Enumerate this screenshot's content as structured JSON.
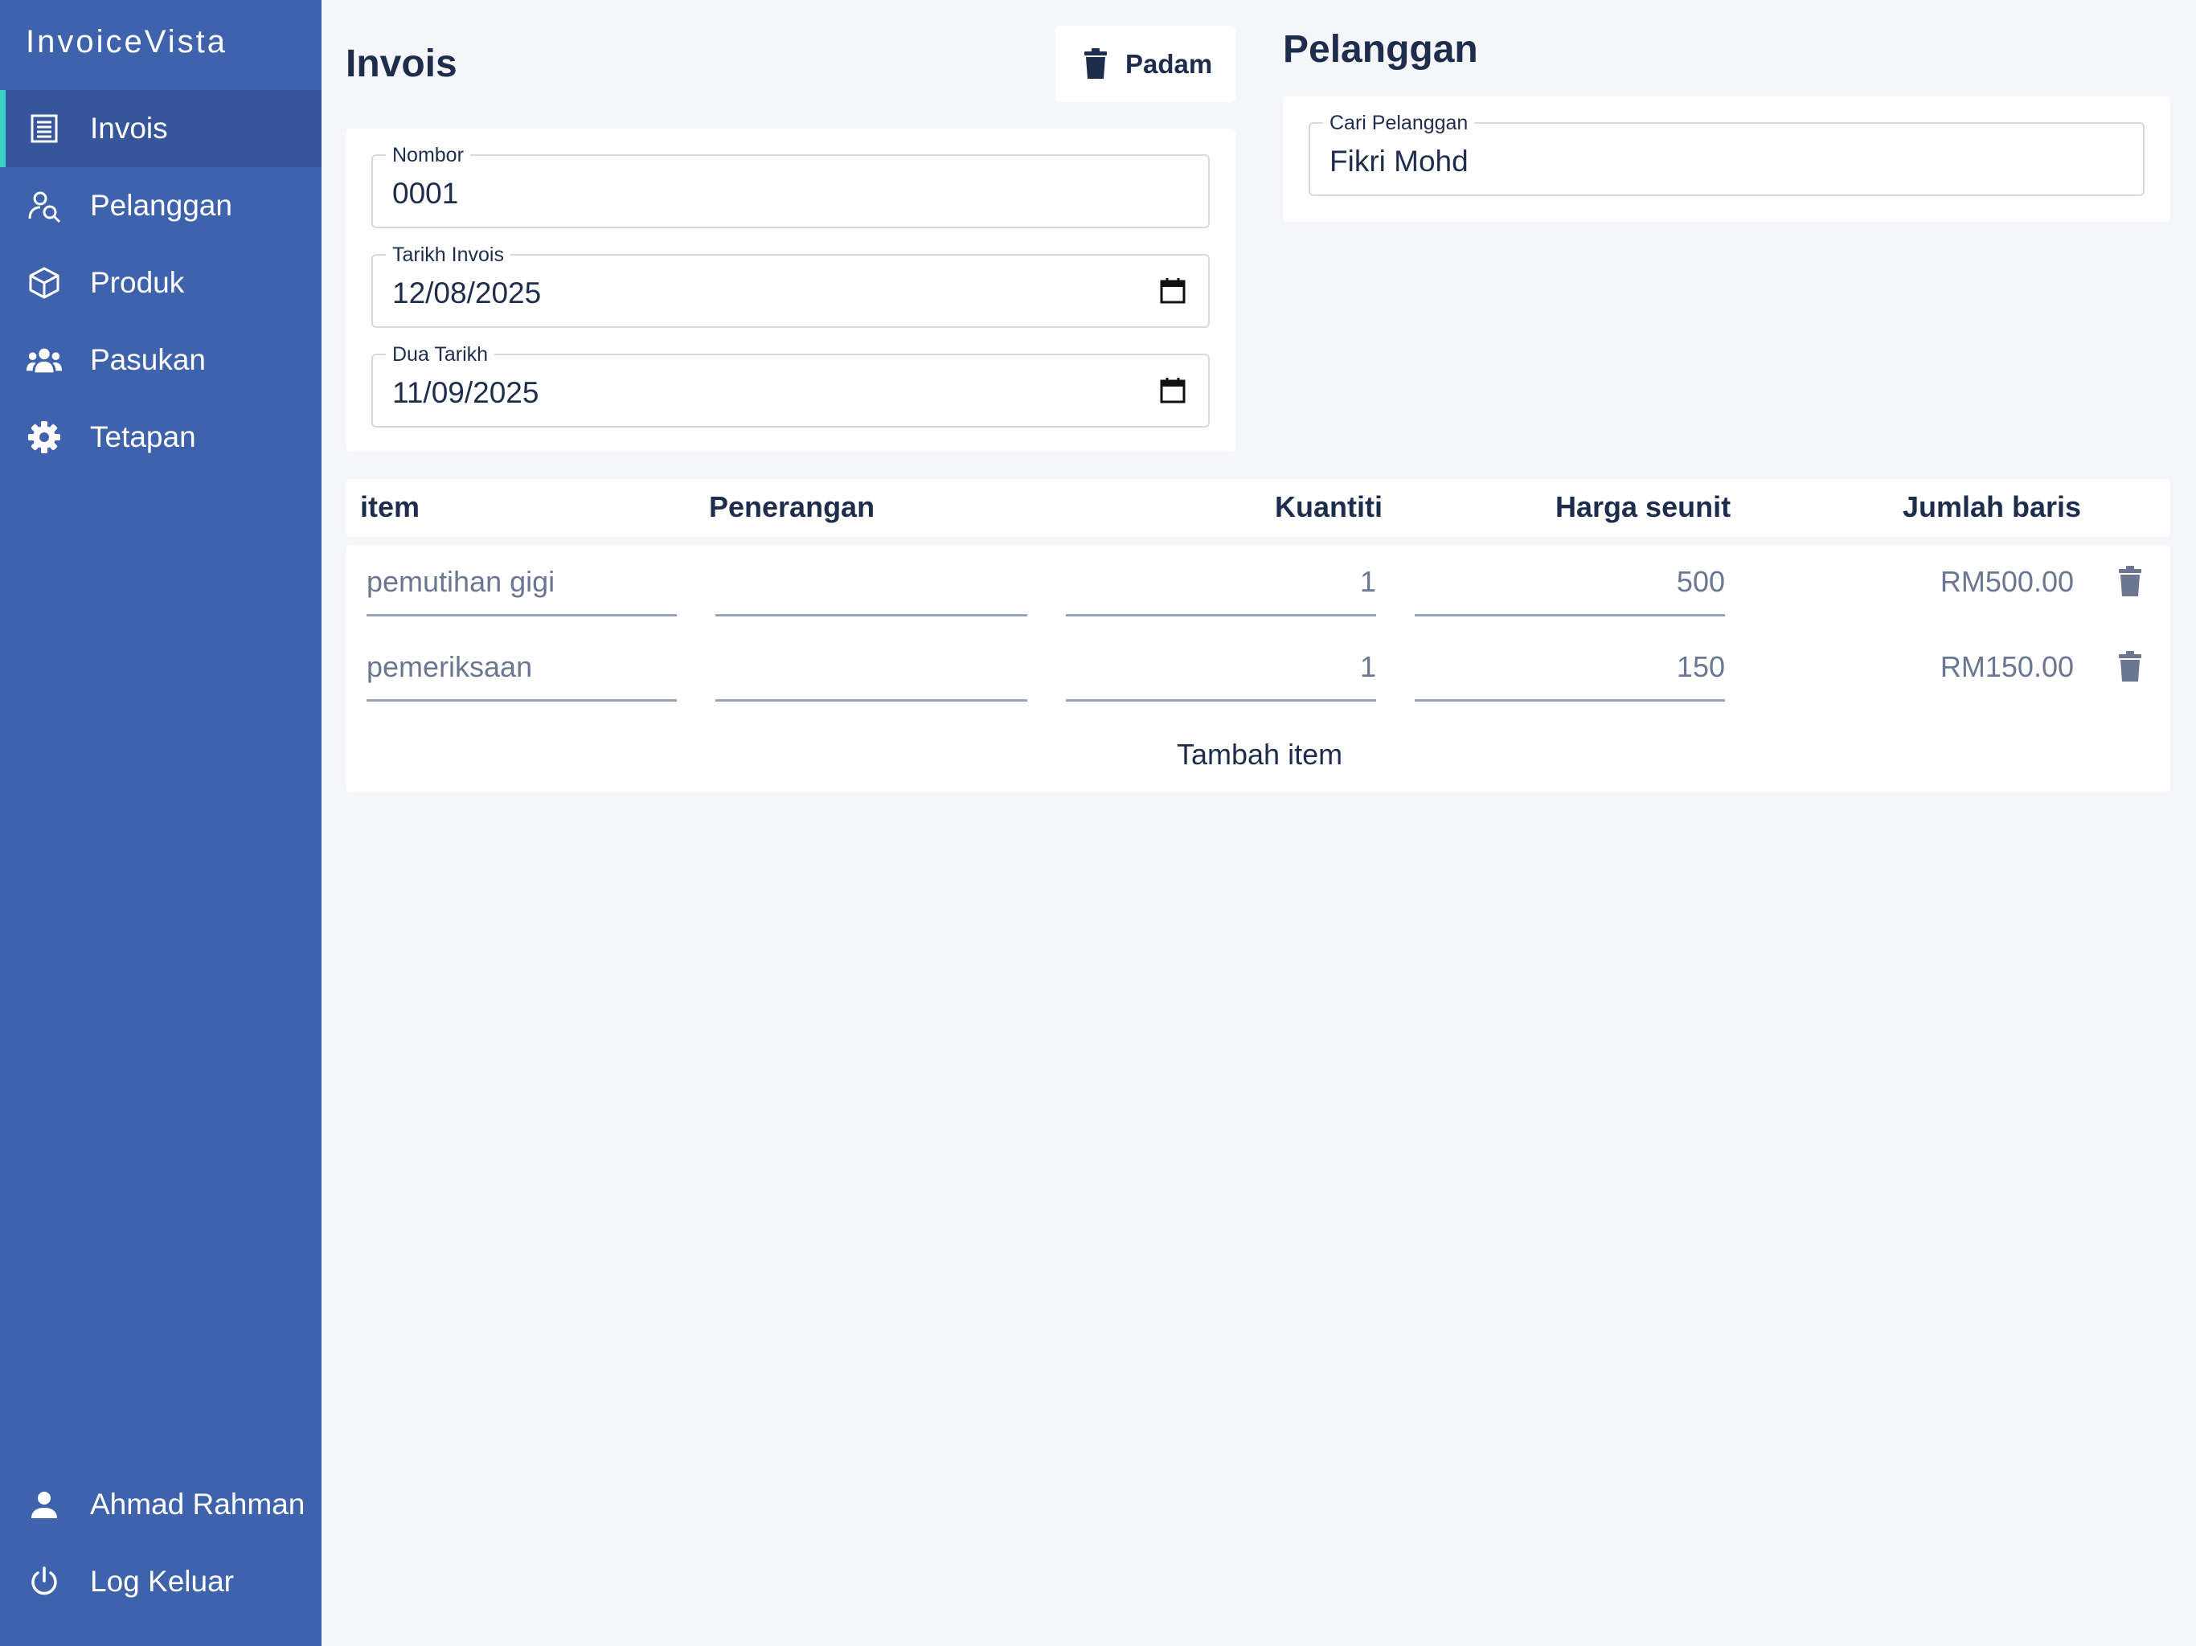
{
  "app": {
    "brand": "InvoiceVista"
  },
  "sidebar": {
    "items": [
      {
        "label": "Invois",
        "icon": "receipt-icon",
        "active": true
      },
      {
        "label": "Pelanggan",
        "icon": "user-search-icon"
      },
      {
        "label": "Produk",
        "icon": "box-icon"
      },
      {
        "label": "Pasukan",
        "icon": "team-icon"
      },
      {
        "label": "Tetapan",
        "icon": "gear-icon"
      }
    ],
    "footer": [
      {
        "label": "Ahmad Rahman",
        "icon": "person-icon"
      },
      {
        "label": "Log Keluar",
        "icon": "power-icon"
      }
    ]
  },
  "invoice": {
    "title": "Invois",
    "delete_label": "Padam",
    "fields": {
      "number": {
        "label": "Nombor",
        "value": "0001"
      },
      "invoice_date": {
        "label": "Tarikh Invois",
        "value": "12/08/2025"
      },
      "due_date": {
        "label": "Dua Tarikh",
        "value": "11/09/2025"
      }
    }
  },
  "customer": {
    "title": "Pelanggan",
    "search": {
      "label": "Cari Pelanggan",
      "value": "Fikri Mohd"
    }
  },
  "table": {
    "headers": [
      "item",
      "Penerangan",
      "Kuantiti",
      "Harga seunit",
      "Jumlah baris"
    ],
    "rows": [
      {
        "item": "pemutihan gigi",
        "description": "",
        "quantity": "1",
        "unit_price": "500",
        "total": "RM500.00"
      },
      {
        "item": "pemeriksaan",
        "description": "",
        "quantity": "1",
        "unit_price": "150",
        "total": "RM150.00"
      }
    ],
    "add_label": "Tambah item"
  },
  "colors": {
    "sidebar_bg": "#3f62ad",
    "sidebar_active": "#36559a",
    "active_accent": "#3bd1c4",
    "page_bg": "#f4f6fa",
    "text_dark": "#1f2d4d"
  }
}
